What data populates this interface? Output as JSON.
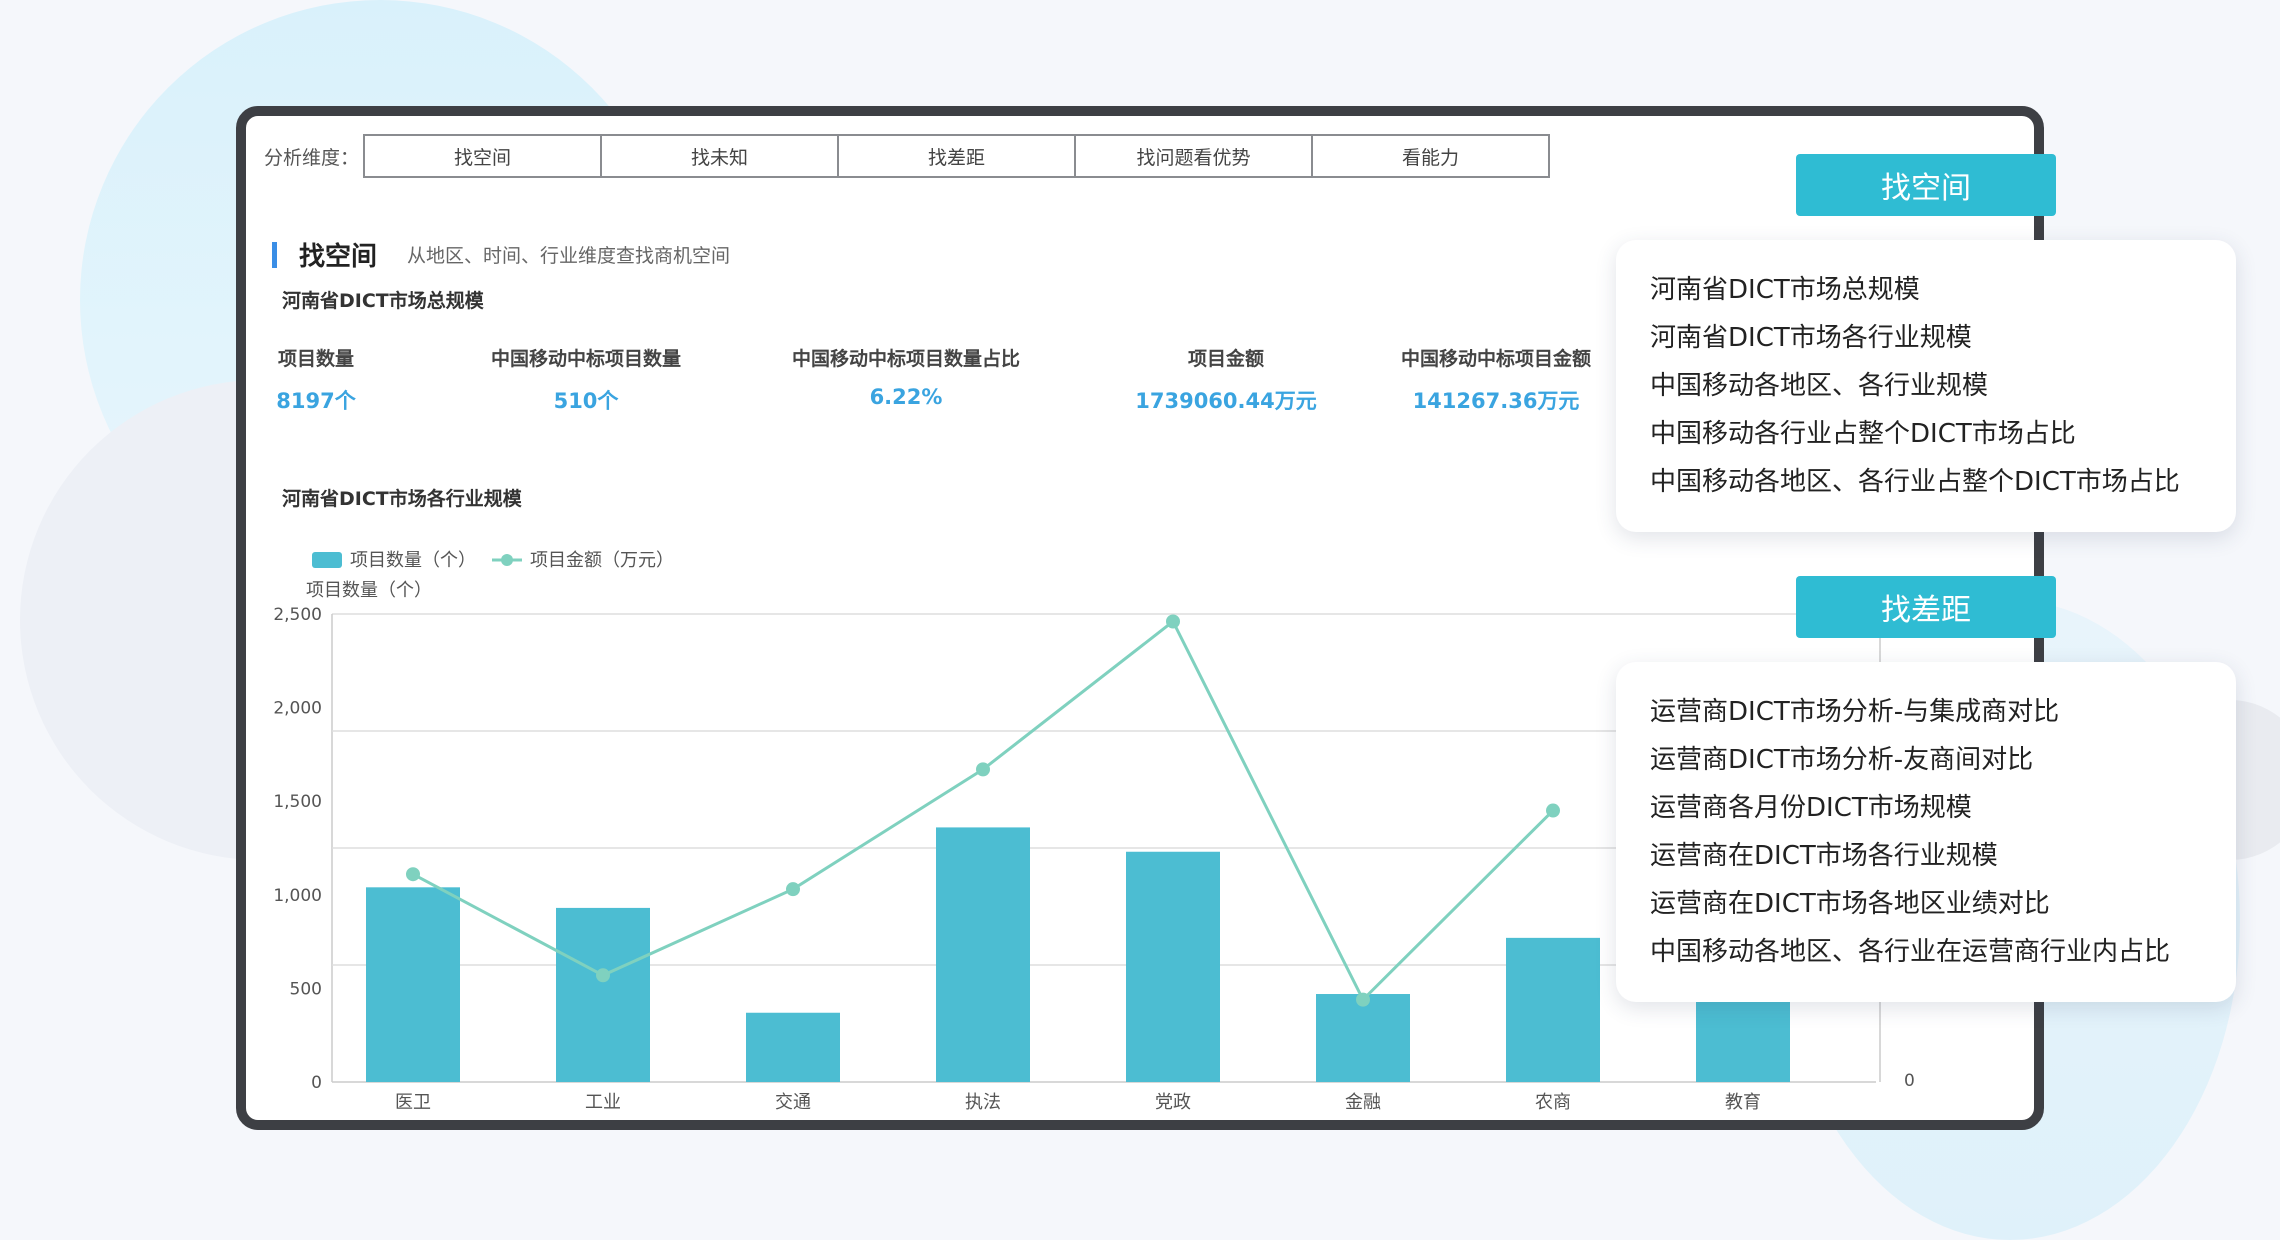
{
  "tabs_label": "分析维度：",
  "tabs": [
    "找空间",
    "找未知",
    "找差距",
    "找问题看优势",
    "看能力"
  ],
  "section": {
    "title": "找空间",
    "subtitle": "从地区、时间、行业维度查找商机空间"
  },
  "total_title": "河南省DICT市场总规模",
  "kpis": [
    {
      "label": "项目数量",
      "value": "8197个"
    },
    {
      "label": "中国移动中标项目数量",
      "value": "510个"
    },
    {
      "label": "中国移动中标项目数量占比",
      "value": "6.22%"
    },
    {
      "label": "项目金额",
      "value": "1739060.44万元"
    },
    {
      "label": "中国移动中标项目金额",
      "value": "141267.36万元"
    }
  ],
  "industry_title": "河南省DICT市场各行业规模",
  "chart_data": {
    "type": "bar",
    "categories": [
      "医卫",
      "工业",
      "交通",
      "执法",
      "党政",
      "金融",
      "农商",
      "教育"
    ],
    "series": [
      {
        "name": "项目数量（个）",
        "kind": "bar",
        "color": "#4cbdd2",
        "values": [
          1040,
          930,
          370,
          1360,
          1230,
          470,
          770,
          850
        ]
      },
      {
        "name": "项目金额（万元）",
        "kind": "line",
        "color": "#7fd1bf",
        "values": [
          1110,
          570,
          1030,
          1670,
          2460,
          440,
          1450,
          null
        ]
      }
    ],
    "ylabel": "项目数量（个）",
    "ylim": [
      0,
      2500
    ],
    "yticks": [
      "0",
      "500",
      "1,000",
      "1,500",
      "2,000",
      "2,500"
    ],
    "right_tick": "0",
    "legend": "top-left",
    "grid": true
  },
  "callout_space": {
    "tag": "找空间",
    "items": [
      "河南省DICT市场总规模",
      "河南省DICT市场各行业规模",
      "中国移动各地区、各行业规模",
      "中国移动各行业占整个DICT市场占比",
      "中国移动各地区、各行业占整个DICT市场占比"
    ]
  },
  "callout_gap": {
    "tag": "找差距",
    "items": [
      "运营商DICT市场分析-与集成商对比",
      "运营商DICT市场分析-友商间对比",
      "运营商各月份DICT市场规模",
      "运营商在DICT市场各行业规模",
      "运营商在DICT市场各地区业绩对比",
      "中国移动各地区、各行业在运营商行业内占比"
    ]
  }
}
